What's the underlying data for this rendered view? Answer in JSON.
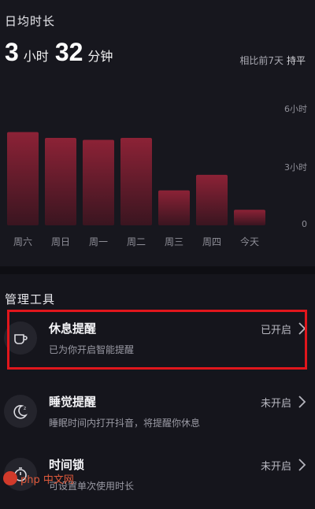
{
  "usage": {
    "title": "日均时长",
    "hours": "3",
    "hours_unit": "小时",
    "minutes": "32",
    "minutes_unit": "分钟",
    "compare_label": "相比前7天",
    "compare_value": "持平"
  },
  "chart_data": {
    "type": "bar",
    "categories": [
      "周六",
      "周日",
      "周一",
      "周二",
      "周三",
      "周四",
      "今天"
    ],
    "values": [
      4.8,
      4.5,
      4.4,
      4.5,
      1.8,
      2.6,
      0.8
    ],
    "ylim": [
      0,
      6
    ],
    "y_tick_labels": [
      "6小时",
      "3小时",
      "0"
    ],
    "colors": {
      "bar_top": "#8c2236",
      "bar_bottom": "#3a1520"
    }
  },
  "tools": {
    "title": "管理工具",
    "items": [
      {
        "name": "休息提醒",
        "desc": "已为你开启智能提醒",
        "status": "已开启",
        "icon": "coffee-cup-icon"
      },
      {
        "name": "睡觉提醒",
        "desc": "睡眠时间内打开抖音，将提醒你休息",
        "status": "未开启",
        "icon": "moon-icon"
      },
      {
        "name": "时间锁",
        "desc": "可设置单次使用时长",
        "status": "未开启",
        "icon": "timer-icon"
      }
    ]
  },
  "watermark": {
    "text": "php 中文网"
  },
  "colors": {
    "highlight_border": "#e0161c",
    "background": "#15151c"
  }
}
